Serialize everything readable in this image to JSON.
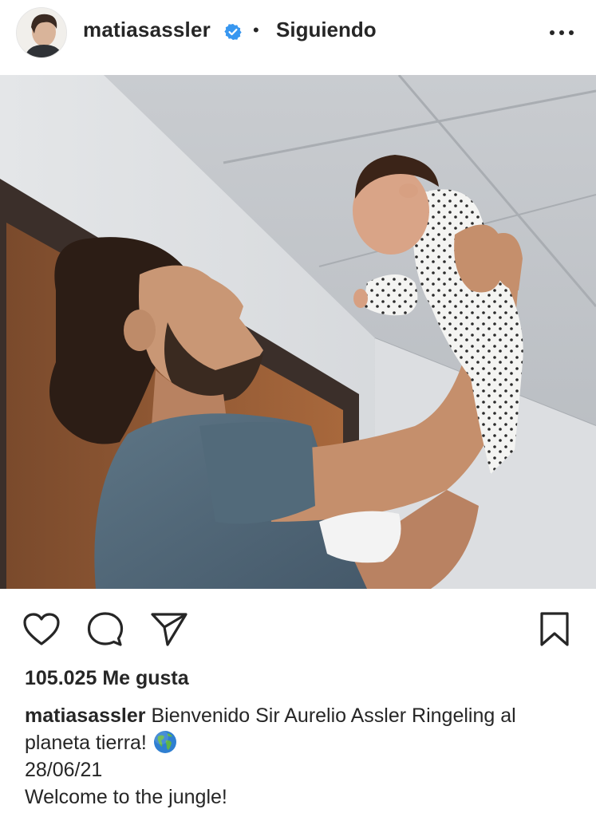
{
  "post": {
    "username": "matiasassler",
    "follow_status": "Siguiendo",
    "separator": "•",
    "likes": "105.025 Me gusta",
    "caption_user": "matiasassler",
    "caption_text": "Bienvenido Sir Aurelio Assler Ringeling al planeta tierra!",
    "caption_emoji": "globe-americas-icon",
    "date_line": "28/06/21",
    "extra_line": "Welcome to the jungle!"
  },
  "colors": {
    "text": "#262626",
    "verified_blue": "#3897f0",
    "background": "#ffffff"
  },
  "icons": [
    "verified-badge-icon",
    "more-options-icon",
    "heart-icon",
    "comment-icon",
    "share-icon",
    "bookmark-icon"
  ]
}
